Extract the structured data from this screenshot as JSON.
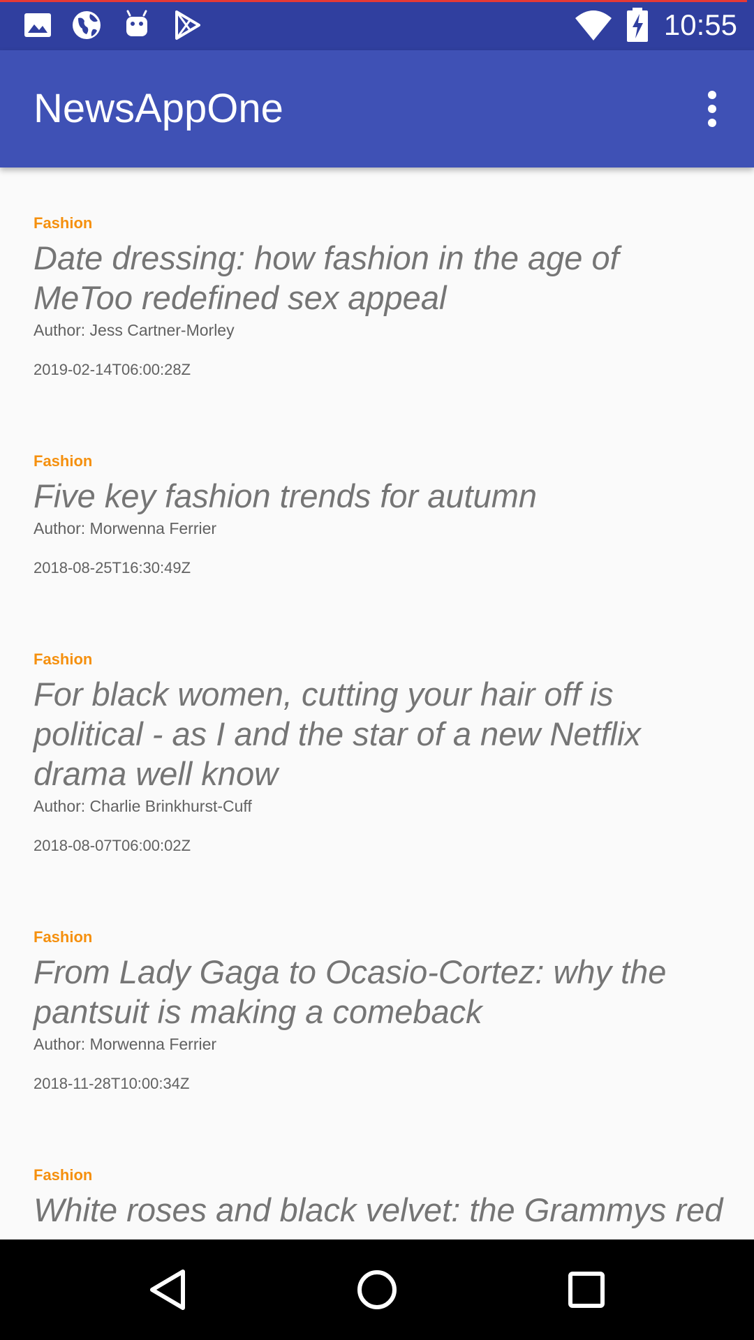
{
  "status_bar": {
    "time": "10:55",
    "icons_left": [
      "image-icon",
      "globe-icon",
      "android-icon",
      "play-store-icon"
    ],
    "icons_right": [
      "wifi-icon",
      "battery-charging-icon"
    ]
  },
  "app_bar": {
    "title": "NewsAppOne",
    "menu_icon": "more-vert-icon"
  },
  "articles": [
    {
      "section": "Fashion",
      "title": "Date dressing: how fashion in the age of\nMeToo redefined sex appeal",
      "author": "Author: Jess Cartner-Morley",
      "date": "2019-02-14T06:00:28Z"
    },
    {
      "section": "Fashion",
      "title": "Five key fashion trends for autumn",
      "author": "Author: Morwenna Ferrier",
      "date": "2018-08-25T16:30:49Z"
    },
    {
      "section": "Fashion",
      "title": "For black women, cutting your hair off is\npolitical - as I and the star of a new Netflix\ndrama well know",
      "author": "Author: Charlie Brinkhurst-Cuff",
      "date": "2018-08-07T06:00:02Z"
    },
    {
      "section": "Fashion",
      "title": "From Lady Gaga to Ocasio-Cortez: why the\npantsuit is making a comeback",
      "author": "Author: Morwenna Ferrier",
      "date": "2018-11-28T10:00:34Z"
    },
    {
      "section": "Fashion",
      "title": "White roses and black velvet: the Grammys red",
      "author": "",
      "date": ""
    }
  ],
  "nav_bar": {
    "buttons": [
      "back-icon",
      "home-icon",
      "recents-icon"
    ]
  },
  "colors": {
    "status_bar": "#303f9f",
    "app_bar": "#3f51b5",
    "section_accent": "#f5900e",
    "title_text": "#757575",
    "background": "#fafafa"
  }
}
